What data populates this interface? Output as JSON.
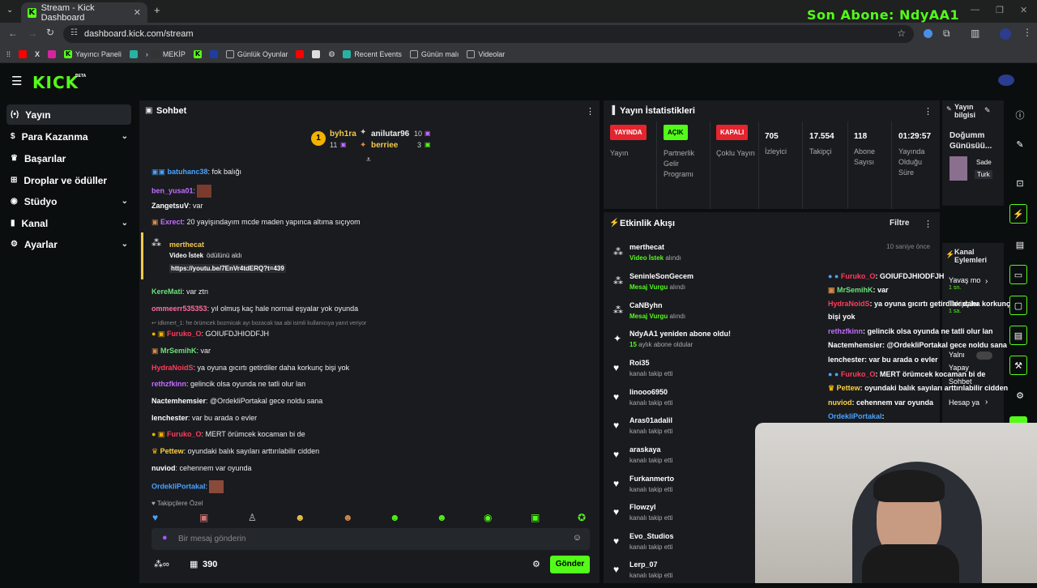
{
  "browser": {
    "tab_title": "Stream - Kick Dashboard",
    "url": "dashboard.kick.com/stream",
    "bookmarks": [
      "Yayıncı Paneli",
      "MEKİP",
      "Günlük Oyunlar",
      "Recent Events",
      "Günün malı",
      "Videolar"
    ]
  },
  "overlay_top": "Son Abone: NdyAA1",
  "logo": "KICK",
  "logo_beta": "BETA",
  "sidebar": [
    {
      "label": "Yayın",
      "chevron": false
    },
    {
      "label": "Para Kazanma",
      "chevron": true
    },
    {
      "label": "Başarılar",
      "chevron": false
    },
    {
      "label": "Droplar ve ödüller",
      "chevron": false
    },
    {
      "label": "Stüdyo",
      "chevron": true
    },
    {
      "label": "Kanal",
      "chevron": true
    },
    {
      "label": "Ayarlar",
      "chevron": true
    }
  ],
  "chat": {
    "title": "Sohbet",
    "top_gifters": {
      "rank": "1",
      "first": {
        "name": "byh1ra",
        "count": "11"
      },
      "second": {
        "name": "anilutar96",
        "count": "10"
      },
      "third": {
        "name": "berriee",
        "count": "3"
      }
    },
    "messages": [
      {
        "user": "batuhanc38",
        "color": "#4aa3ff",
        "text": ": fok balığı"
      },
      {
        "user": "ben_yusa01",
        "color": "#c46cff",
        "text": ":"
      },
      {
        "user": "ZangetsuV",
        "color": "#ffffff",
        "text": ": var"
      },
      {
        "user": "Exrect",
        "color": "#c46cff",
        "text": ": 20 yayişındayım mcde maden yapınca altıma sıçıyom"
      },
      {
        "user": "KereMati",
        "color": "#6de07a",
        "text": ": var ztn"
      },
      {
        "user": "ommeerr535353",
        "color": "#ff6f9a",
        "text": ": yıl olmuş kaç hale normal eşyalar yok oyunda"
      },
      {
        "user": "Furuko_O",
        "color": "#ff3b5c",
        "text": ": GOIUFDJHIODFJH"
      },
      {
        "user": "MrSemihK",
        "color": "#6de07a",
        "text": ": var"
      },
      {
        "user": "HydraNoidS",
        "color": "#ff3b5c",
        "text": ": ya oyuna gıcırtı getirdiler daha korkunç bişi yok"
      },
      {
        "user": "rethzfkinn",
        "color": "#c46cff",
        "text": ": gelincik olsa oyunda ne tatli olur lan"
      },
      {
        "user": "Nactemhemsier",
        "color": "#ffffff",
        "text": ": @OrdekliPortakal gece noldu sana"
      },
      {
        "user": "lenchester",
        "color": "#ffffff",
        "text": ": var bu arada o evler"
      },
      {
        "user": "Furuko_O",
        "color": "#ff3b5c",
        "text": ": MERT örümcek kocaman bi de"
      },
      {
        "user": "Pettew",
        "color": "#ffd23f",
        "text": ": oyundaki balık sayıları arttırılabilir cidden"
      },
      {
        "user": "nuviod",
        "color": "#ffffff",
        "text": ": cehennem var oyunda"
      },
      {
        "user": "OrdekliPortakal",
        "color": "#4aa3ff",
        "text": ":"
      }
    ],
    "reward": {
      "user": "merthecat",
      "line": "Video İstek",
      "line_suffix": "ödülünü aldı",
      "link": "https://youtu.be/7EnVr4tdERQ?t=439"
    },
    "reply_preview": "idkmert_1: he örümcek bozmicak ayı bozacak taa abi isimli kullanıcıya yanıt veriyor",
    "emote_label": "Takipçilere Özel",
    "input_placeholder": "Bir mesaj gönderin",
    "points": "390",
    "send_label": "Gönder"
  },
  "stats": {
    "title": "Yayın İstatistikleri",
    "columns": [
      {
        "badge": "YAYINDA",
        "badge_color": "#e4252f",
        "label": "Yayın"
      },
      {
        "badge": "AÇIK",
        "badge_color": "#53fc18",
        "label": "Partnerlik Gelir Programı"
      },
      {
        "badge": "KAPALI",
        "badge_color": "#e4252f",
        "label": "Çoklu Yayın"
      },
      {
        "value": "705",
        "label": "İzleyici"
      },
      {
        "value": "17.554",
        "label": "Takipçi"
      },
      {
        "value": "118",
        "label": "Abone Sayısı"
      },
      {
        "value": "01:29:57",
        "label": "Yayında Olduğu Süre"
      }
    ]
  },
  "activity": {
    "title": "Etkinlik Akışı",
    "filter": "Filtre",
    "events": [
      {
        "name": "merthecat",
        "sub_hl": "Video İstek",
        "sub": "alındı",
        "time": "10 saniye önce",
        "icon": "coins"
      },
      {
        "name": "SeninleSonGecem",
        "sub_hl": "Mesaj Vurgu",
        "sub": "alındı",
        "time": "",
        "icon": "coins"
      },
      {
        "name": "CaNByhn",
        "sub_hl": "Mesaj Vurgu",
        "sub": "alındı",
        "time": "",
        "icon": "coins"
      },
      {
        "name": "NdyAA1 yeniden abone oldu!",
        "sub_hl": "15",
        "sub": "aylık abone oldular",
        "time": "",
        "icon": "star"
      },
      {
        "name": "Roi35",
        "sub_hl": "",
        "sub": "kanalı takip etti",
        "time": "",
        "icon": "heart"
      },
      {
        "name": "linooo6950",
        "sub_hl": "",
        "sub": "kanalı takip etti",
        "time": "",
        "icon": "heart"
      },
      {
        "name": "Aras01adalil",
        "sub_hl": "",
        "sub": "kanalı takip etti",
        "time": "",
        "icon": "heart"
      },
      {
        "name": "araskaya",
        "sub_hl": "",
        "sub": "kanalı takip etti",
        "time": "",
        "icon": "heart"
      },
      {
        "name": "Furkanmerto",
        "sub_hl": "",
        "sub": "kanalı takip etti",
        "time": "",
        "icon": "heart"
      },
      {
        "name": "Flowzyl",
        "sub_hl": "",
        "sub": "kanalı takip etti",
        "time": "",
        "icon": "heart"
      },
      {
        "name": "Evo_Studios",
        "sub_hl": "",
        "sub": "kanalı takip etti",
        "time": "",
        "icon": "heart"
      },
      {
        "name": "Lerp_07",
        "sub_hl": "",
        "sub": "kanalı takip etti",
        "time": "",
        "icon": "heart"
      }
    ]
  },
  "stream_info": {
    "title": "Yayın bilgisi",
    "stream_title": "Doğumm Günüsüü...",
    "category": "Sade",
    "tag": "Turk"
  },
  "channel_actions": {
    "title": "Kanal Eylemleri",
    "items": [
      "Yavaş mo",
      "1 sn.",
      "Takipçiler",
      "1 sa.",
      "Yalnı",
      "Yapay",
      "Sohbet",
      "Hesap ya"
    ]
  },
  "overlay_chat": [
    {
      "user": "Furuko_O",
      "color": "#ff3b5c",
      "text": ": GOIUFDJHIODFJH"
    },
    {
      "user": "MrSemihK",
      "color": "#6de07a",
      "text": ": var"
    },
    {
      "user": "HydraNoidS",
      "color": "#ff3b5c",
      "text": ": ya oyuna gıcırtı getirdiler daha korkunç"
    },
    {
      "user": "",
      "color": "#ffffff",
      "text": "bişi yok"
    },
    {
      "user": "rethzfkinn",
      "color": "#c46cff",
      "text": ": gelincik olsa oyunda ne tatli olur lan"
    },
    {
      "user": "Nactemhemsier",
      "color": "#ffffff",
      "text": ": @OrdekliPortakal gece noldu sana"
    },
    {
      "user": "lenchester",
      "color": "#ffffff",
      "text": ": var bu arada o evler"
    },
    {
      "user": "Furuko_O",
      "color": "#ff3b5c",
      "text": ": MERT örümcek kocaman bi de"
    },
    {
      "user": "Pettew",
      "color": "#ffd23f",
      "text": ": oyundaki balık sayıları arttırılabilir cidden"
    },
    {
      "user": "nuviod",
      "color": "#ffd23f",
      "text": ": cehennem var oyunda"
    },
    {
      "user": "OrdekliPortakal",
      "color": "#4aa3ff",
      "text": ":"
    }
  ],
  "colors": {
    "accent": "#53fc18",
    "live": "#e4252f"
  }
}
